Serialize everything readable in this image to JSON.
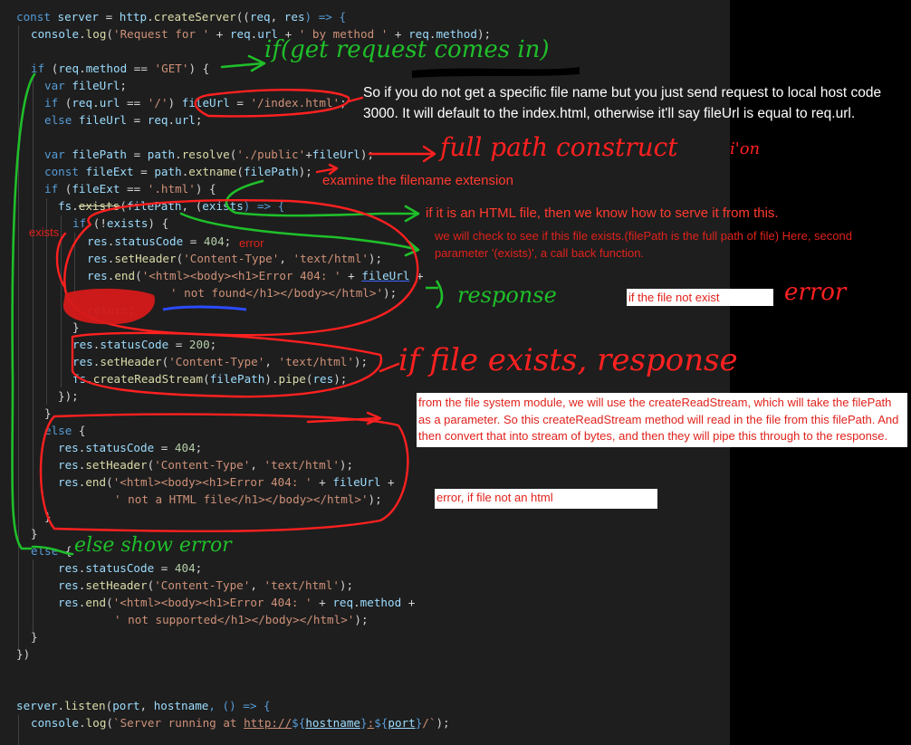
{
  "code": {
    "l01": {
      "a": "const",
      "b": "server",
      "c": " = ",
      "d": "http",
      "e": ".",
      "f": "createServer",
      "g": "((",
      "h": "req",
      "i": ", ",
      "j": "res",
      "k": ") => {"
    },
    "l02": {
      "a": "console",
      "b": ".",
      "c": "log",
      "d": "(",
      "e": "'Request for '",
      "f": " + ",
      "g": "req",
      "h": ".",
      "i": "url",
      "j": " + ",
      "k": "' by method '",
      "l": " + ",
      "m": "req",
      "n": ".",
      "o": "method",
      "p": ");"
    },
    "l03": {
      "a": "if",
      "b": " (",
      "c": "req",
      "d": ".",
      "e": "method",
      "f": " == ",
      "g": "'GET'",
      "h": ") {"
    },
    "l04": {
      "a": "var",
      "b": " fileUrl",
      "c": ";"
    },
    "l05": {
      "a": "if",
      "b": " (",
      "c": "req",
      "d": ".",
      "e": "url",
      "f": " == ",
      "g": "'/'",
      "h": ") ",
      "i": "fileUrl",
      "j": " = ",
      "k": "'/index.html'",
      "l": ";"
    },
    "l06": {
      "a": "else",
      "b": " fileUrl",
      "c": " = ",
      "d": "req",
      "e": ".",
      "f": "url",
      "g": ";"
    },
    "l07": {
      "a": "var",
      "b": " filePath",
      "c": " = ",
      "d": "path",
      "e": ".",
      "f": "resolve",
      "g": "(",
      "h": "'./public'",
      "i": "+",
      "j": "fileUrl",
      "k": ");"
    },
    "l08": {
      "a": "const",
      "b": " fileExt",
      "c": " = ",
      "d": "path",
      "e": ".",
      "f": "extname",
      "g": "(",
      "h": "filePath",
      "i": ");"
    },
    "l09": {
      "a": "if",
      "b": " (",
      "c": "fileExt",
      "d": " == ",
      "e": "'.html'",
      "f": ") {"
    },
    "l10": {
      "a": "fs",
      "b": ".",
      "c": "exists",
      "d": "(",
      "e": "filePath",
      "f": ", (",
      "g": "exists",
      "h": ") => {"
    },
    "l11": {
      "a": "if",
      "b": " (!",
      "c": "exists",
      "d": ") {"
    },
    "l12": {
      "a": "res",
      "b": ".",
      "c": "statusCode",
      "d": " = ",
      "e": "404",
      "f": ";"
    },
    "l13": {
      "a": "res",
      "b": ".",
      "c": "setHeader",
      "d": "(",
      "e": "'Content-Type'",
      "f": ", ",
      "g": "'text/html'",
      "h": ");"
    },
    "l14": {
      "a": "res",
      "b": ".",
      "c": "end",
      "d": "(",
      "e": "'<html><body><h1>Error 404: '",
      "f": " + ",
      "g": "fileUrl",
      "h": " +"
    },
    "l15": {
      "a": "' not found</h1></body></html>'",
      "b": ");"
    },
    "l16": {
      "a": "return",
      "b": ";"
    },
    "l17": {
      "a": "}"
    },
    "l18": {
      "a": "res",
      "b": ".",
      "c": "statusCode",
      "d": " = ",
      "e": "200",
      "f": ";"
    },
    "l19": {
      "a": "res",
      "b": ".",
      "c": "setHeader",
      "d": "(",
      "e": "'Content-Type'",
      "f": ", ",
      "g": "'text/html'",
      "h": ");"
    },
    "l20": {
      "a": "fs",
      "b": ".",
      "c": "createReadStream",
      "d": "(",
      "e": "filePath",
      "f": ").",
      "g": "pipe",
      "h": "(",
      "i": "res",
      "j": ");"
    },
    "l21": {
      "a": "});"
    },
    "l22": {
      "a": "}"
    },
    "l23": {
      "a": "else",
      "b": " {"
    },
    "l24": {
      "a": "res",
      "b": ".",
      "c": "statusCode",
      "d": " = ",
      "e": "404",
      "f": ";"
    },
    "l25": {
      "a": "res",
      "b": ".",
      "c": "setHeader",
      "d": "(",
      "e": "'Content-Type'",
      "f": ", ",
      "g": "'text/html'",
      "h": ");"
    },
    "l26": {
      "a": "res",
      "b": ".",
      "c": "end",
      "d": "(",
      "e": "'<html><body><h1>Error 404: '",
      "f": " + ",
      "g": "fileUrl",
      "h": " +"
    },
    "l27": {
      "a": "' not a HTML file</h1></body></html>'",
      "b": ");"
    },
    "l28": {
      "a": "}"
    },
    "l29": {
      "a": "}"
    },
    "l30": {
      "a": "else",
      "b": " {"
    },
    "l31": {
      "a": "res",
      "b": ".",
      "c": "statusCode",
      "d": " = ",
      "e": "404",
      "f": ";"
    },
    "l32": {
      "a": "res",
      "b": ".",
      "c": "setHeader",
      "d": "(",
      "e": "'Content-Type'",
      "f": ", ",
      "g": "'text/html'",
      "h": ");"
    },
    "l33": {
      "a": "res",
      "b": ".",
      "c": "end",
      "d": "(",
      "e": "'<html><body><h1>Error 404: '",
      "f": " + ",
      "g": "req",
      "h": ".",
      "i": "method",
      "j": " +"
    },
    "l34": {
      "a": "' not supported</h1></body></html>'",
      "b": ");"
    },
    "l35": {
      "a": "}"
    },
    "l36": {
      "a": "})"
    },
    "l37": {
      "a": "server",
      "b": ".",
      "c": "listen",
      "d": "(",
      "e": "port",
      "f": ", ",
      "g": "hostname",
      "h": ", () => {"
    },
    "l38": {
      "a": "console",
      "b": ".",
      "c": "log",
      "d": "(",
      "e": "`Server running at ",
      "f": "http://",
      "g": "${",
      "h": "hostname",
      "i": "}",
      "j": ":",
      "k": "${",
      "l": "port",
      "m": "}",
      "n": "/`",
      "o": ");"
    }
  },
  "annotations": {
    "note_default": "So if you do not get a specific file name but you just send request to local host code 3000. It will default to the index.html, otherwise it'll say fileUrl is equal to req.url.",
    "note_extension": "examine the filename extension",
    "note_html": "if it is an HTML file, then we know how to serve it from this.",
    "note_exists": "we will check to see if this file exists.(filePath is the full path of file) Here, second parameter '(exists)', a call back function.",
    "label_exists": "exists",
    "label_error": "error",
    "box_not_exist": "if the file not exist",
    "box_stream": "from the file system module, we will use the createReadStream, which will take the filePath as a parameter. So this createReadStream method will read in the file from this filePath. And then convert that into stream of bytes, and then they will pipe this through to the response.",
    "box_not_html": "error, if file not an html",
    "hand_get": "if(get request comes in)",
    "hand_fullpath": "full path construct",
    "hand_ion": "i'on",
    "hand_response": "response",
    "hand_error": "error",
    "hand_exists": "if file exists, response",
    "hand_else": "else show error"
  },
  "colors": {
    "editor_bg": "#1e1e1e",
    "keyword": "#569cd6",
    "variable": "#9cdcfe",
    "function": "#dcdcaa",
    "string": "#ce9178",
    "number": "#b5cea8",
    "ink_green": "#1fbf2a",
    "ink_red": "#ff2020"
  }
}
